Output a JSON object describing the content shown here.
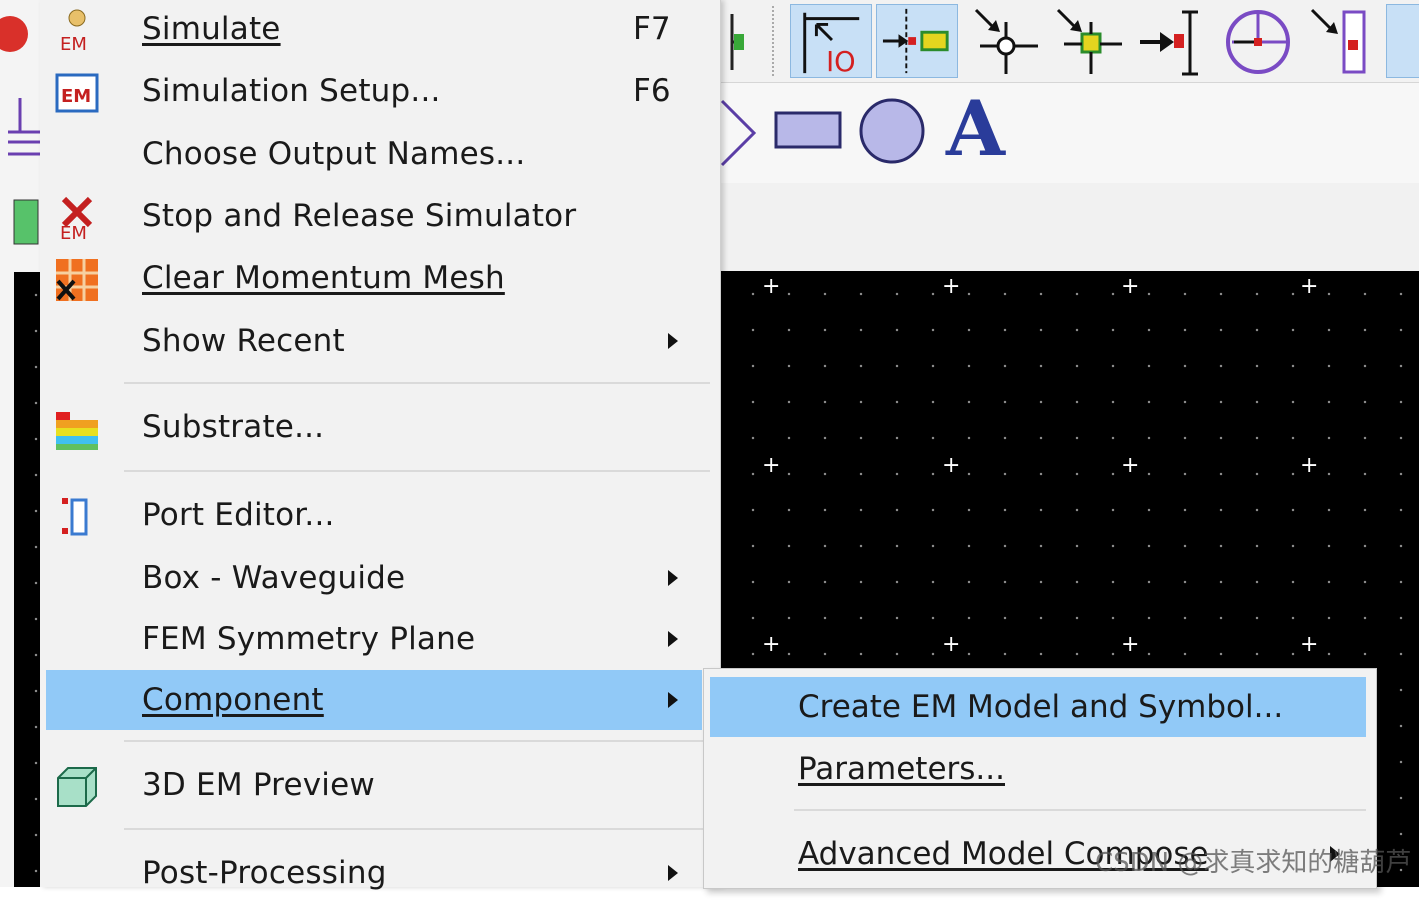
{
  "menu": {
    "items": [
      {
        "label": "Simulate",
        "underline_index": 0,
        "shortcut": "F7",
        "icon": "em-simulate-icon"
      },
      {
        "label": "Simulation Setup...",
        "underline_index": 15,
        "shortcut": "F6",
        "icon": "em-setup-icon"
      },
      {
        "label": "Choose Output Names...",
        "underline_index": 14
      },
      {
        "label": "Stop and Release Simulator",
        "underline_index": 9,
        "icon": "em-stop-icon"
      },
      {
        "label": "Clear Momentum Mesh",
        "underline_index": 0,
        "icon": "clear-mesh-icon"
      },
      {
        "label": "Show Recent",
        "submenu": true
      },
      {
        "label": "Substrate...",
        "icon": "substrate-icon"
      },
      {
        "label": "Port Editor...",
        "icon": "port-editor-icon"
      },
      {
        "label": "Box - Waveguide",
        "underline_index": 0,
        "submenu": true
      },
      {
        "label": "FEM Symmetry Plane",
        "submenu": true
      },
      {
        "label": "Component",
        "underline_index": 0,
        "submenu": true,
        "highlighted": true
      },
      {
        "label": "3D EM Preview",
        "icon": "3d-preview-icon"
      },
      {
        "label": "Post-Processing",
        "submenu": true
      }
    ]
  },
  "submenu": {
    "items": [
      {
        "label": "Create EM Model and Symbol...",
        "highlighted": true
      },
      {
        "label": "Parameters...",
        "underline_index": 0
      },
      {
        "label": "Advanced Model Compose",
        "underline_index": 0,
        "submenu": true
      }
    ]
  },
  "toolbar": {
    "tools": [
      "select-tool-icon",
      "insert-pin-icon",
      "insert-node-icon",
      "insert-port-icon",
      "insert-ground-icon",
      "probe-icon",
      "port-select-icon"
    ],
    "shapes": [
      "polygon-icon",
      "rectangle-icon",
      "circle-icon",
      "text-icon"
    ],
    "text_glyph": "A"
  },
  "watermark": "CSDN @求真求知的糖葫芦",
  "colors": {
    "highlight": "#91c9f7",
    "menu_bg": "#f2f2f2",
    "canvas": "#000000"
  }
}
